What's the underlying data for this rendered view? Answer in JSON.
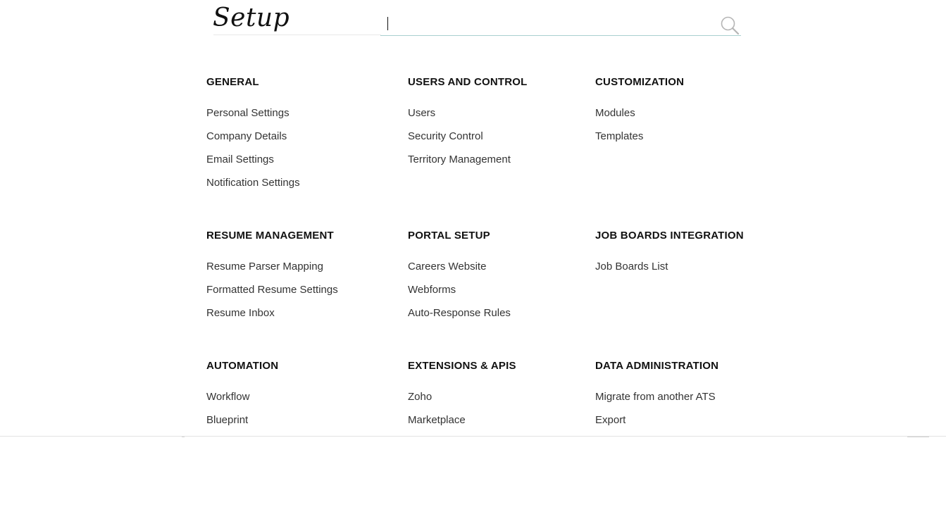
{
  "header": {
    "title": "Setup",
    "search": {
      "value": "",
      "placeholder": ""
    }
  },
  "sections": [
    {
      "heading": "GENERAL",
      "items": [
        "Personal Settings",
        "Company Details",
        "Email Settings",
        "Notification Settings"
      ]
    },
    {
      "heading": "USERS AND CONTROL",
      "items": [
        "Users",
        "Security Control",
        "Territory Management"
      ]
    },
    {
      "heading": "CUSTOMIZATION",
      "items": [
        "Modules",
        "Templates"
      ]
    },
    {
      "heading": "RESUME MANAGEMENT",
      "items": [
        "Resume Parser Mapping",
        "Formatted Resume Settings",
        "Resume Inbox"
      ]
    },
    {
      "heading": "PORTAL SETUP",
      "items": [
        "Careers Website",
        "Webforms",
        "Auto-Response Rules"
      ]
    },
    {
      "heading": "JOB BOARDS INTEGRATION",
      "items": [
        "Job Boards List"
      ]
    },
    {
      "heading": "AUTOMATION",
      "items": [
        "Workflow",
        "Blueprint"
      ]
    },
    {
      "heading": "EXTENSIONS & APIS",
      "items": [
        "Zoho",
        "Marketplace"
      ]
    },
    {
      "heading": "DATA ADMINISTRATION",
      "items": [
        "Migrate from another ATS",
        "Export"
      ]
    }
  ],
  "colors": {
    "heading": "#111111",
    "link": "#333333",
    "search_underline": "#a9d0cf"
  },
  "icons": {
    "search": "search-icon"
  }
}
